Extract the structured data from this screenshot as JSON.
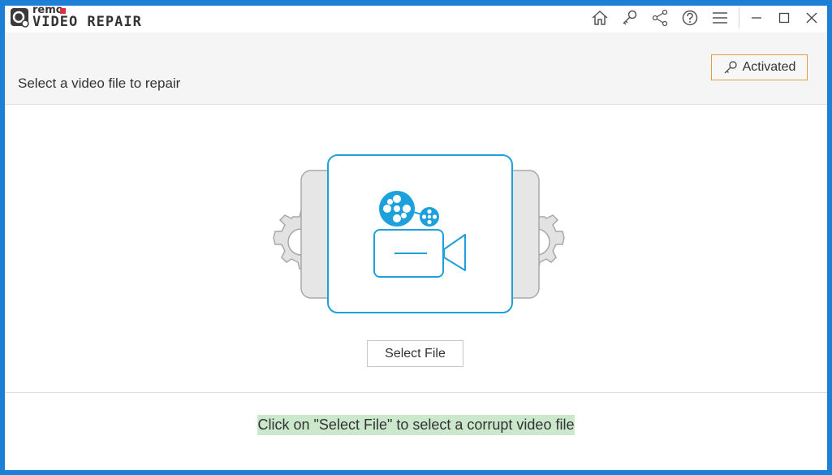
{
  "app": {
    "logo_small": "remo",
    "logo_main": "VIDEO REPAIR"
  },
  "titlebar": {
    "icons": [
      "home-icon",
      "key-icon",
      "share-icon",
      "help-icon",
      "menu-icon",
      "minimize-icon",
      "maximize-icon",
      "close-icon"
    ]
  },
  "header": {
    "title": "Select a video file to repair",
    "activated_label": "Activated"
  },
  "main": {
    "select_file_label": "Select File",
    "hint": "Click on \"Select File\" to select a corrupt video file"
  },
  "colors": {
    "window_border": "#1e7fd6",
    "accent_blue": "#1ea0dc",
    "activated_border": "#e09a4a",
    "hint_highlight": "#cce8cc"
  }
}
